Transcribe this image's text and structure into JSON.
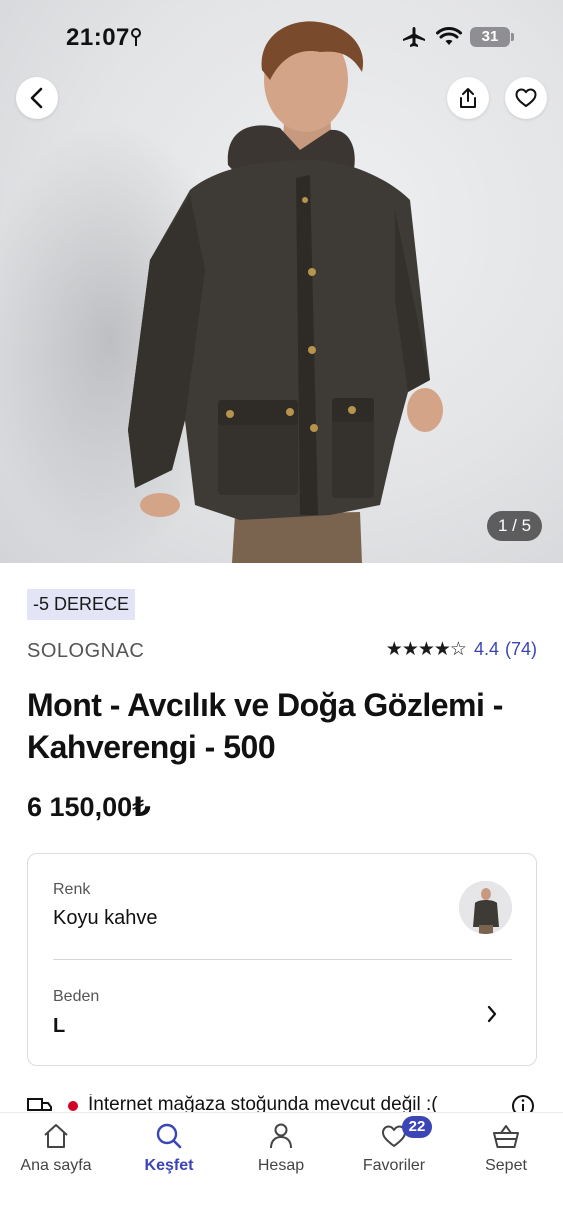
{
  "status_bar": {
    "time": "21:07",
    "battery": "31",
    "icons": [
      "location-arrow-icon",
      "airplane-icon",
      "wifi-icon",
      "battery-icon"
    ]
  },
  "gallery": {
    "pager": "1 / 5",
    "actions": [
      "back-icon",
      "share-icon",
      "heart-icon"
    ]
  },
  "product": {
    "badge": "-5 DERECE",
    "brand": "SOLOGNAC",
    "rating": {
      "stars": 4.4,
      "stars_text": "★★★★☆",
      "value": "4.4",
      "count": "(74)"
    },
    "title": "Mont - Avcılık ve Doğa Gözlemi - Kahverengi - 500",
    "price": "6 150,00₺"
  },
  "options": {
    "color_label": "Renk",
    "color_value": "Koyu kahve",
    "size_label": "Beden",
    "size_value": "L"
  },
  "stock": {
    "text": "İnternet mağaza stoğunda mevcut değil :(",
    "status_color": "#d10024"
  },
  "tabbar": {
    "items": [
      {
        "label": "Ana sayfa",
        "icon": "home-icon"
      },
      {
        "label": "Keşfet",
        "icon": "search-icon",
        "active": true
      },
      {
        "label": "Hesap",
        "icon": "user-icon"
      },
      {
        "label": "Favoriler",
        "icon": "heart-icon",
        "badge": "22"
      },
      {
        "label": "Sepet",
        "icon": "basket-icon"
      }
    ]
  },
  "colors": {
    "accent": "#3b45b5",
    "badge_bg": "#e3e5f6"
  }
}
